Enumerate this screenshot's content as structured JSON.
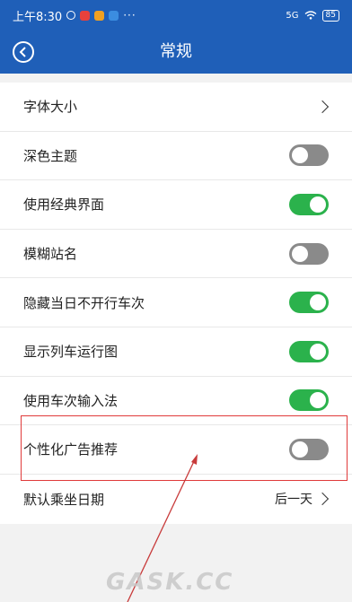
{
  "status_bar": {
    "time": "上午8:30",
    "dots": "···",
    "signal": "5G",
    "battery": "85"
  },
  "header": {
    "title": "常规"
  },
  "settings": [
    {
      "label": "字体大小",
      "control": "chevron"
    },
    {
      "label": "深色主题",
      "control": "toggle",
      "on": false
    },
    {
      "label": "使用经典界面",
      "control": "toggle",
      "on": true
    },
    {
      "label": "模糊站名",
      "control": "toggle",
      "on": false
    },
    {
      "label": "隐藏当日不开行车次",
      "control": "toggle",
      "on": true
    },
    {
      "label": "显示列车运行图",
      "control": "toggle",
      "on": true
    },
    {
      "label": "使用车次输入法",
      "control": "toggle",
      "on": true
    },
    {
      "label": "个性化广告推荐",
      "control": "toggle",
      "on": false
    },
    {
      "label": "默认乘坐日期",
      "control": "value",
      "value": "后一天"
    }
  ],
  "watermark": "GASK.CC",
  "colors": {
    "primary": "#1f5fb8",
    "toggle_on": "#2bb24c",
    "toggle_off": "#8a8a8a",
    "annotation": "#e03a3a"
  }
}
